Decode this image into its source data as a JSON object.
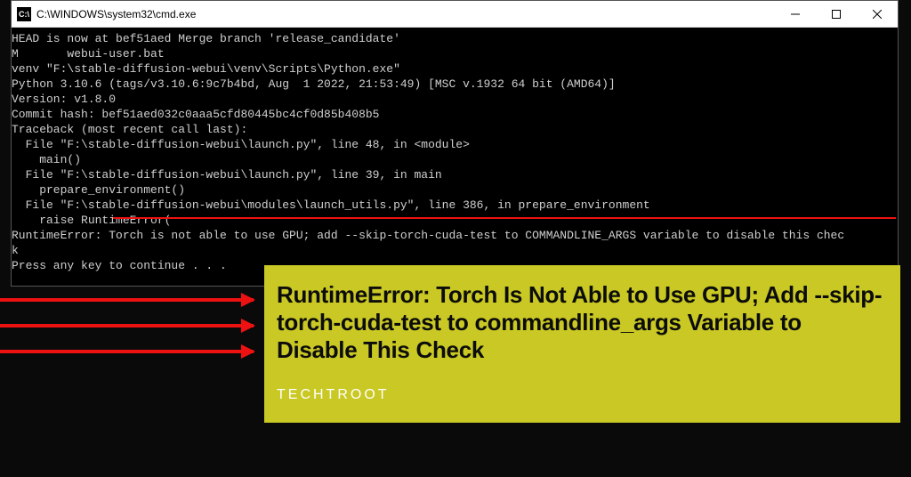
{
  "window": {
    "icon_label": "C:\\",
    "title": "C:\\WINDOWS\\system32\\cmd.exe"
  },
  "terminal": {
    "lines": [
      "HEAD is now at bef51aed Merge branch 'release_candidate'",
      "M       webui-user.bat",
      "venv \"F:\\stable-diffusion-webui\\venv\\Scripts\\Python.exe\"",
      "Python 3.10.6 (tags/v3.10.6:9c7b4bd, Aug  1 2022, 21:53:49) [MSC v.1932 64 bit (AMD64)]",
      "Version: v1.8.0",
      "Commit hash: bef51aed032c0aaa5cfd80445bc4cf0d85b408b5",
      "Traceback (most recent call last):",
      "  File \"F:\\stable-diffusion-webui\\launch.py\", line 48, in <module>",
      "    main()",
      "  File \"F:\\stable-diffusion-webui\\launch.py\", line 39, in main",
      "    prepare_environment()",
      "  File \"F:\\stable-diffusion-webui\\modules\\launch_utils.py\", line 386, in prepare_environment",
      "    raise RuntimeError(",
      "RuntimeError: Torch is not able to use GPU; add --skip-torch-cuda-test to COMMANDLINE_ARGS variable to disable this chec",
      "k",
      "Press any key to continue . . ."
    ]
  },
  "callout": {
    "headline": "RuntimeError: Torch Is Not Able to Use GPU; Add --skip-torch-cuda-test to commandline_args Variable to Disable This Check",
    "brand": "TECHTROOT"
  },
  "colors": {
    "accent_yellow": "#c9c824",
    "arrow_red": "#ee1111",
    "terminal_bg": "#000000",
    "terminal_fg": "#cfcfcf"
  }
}
